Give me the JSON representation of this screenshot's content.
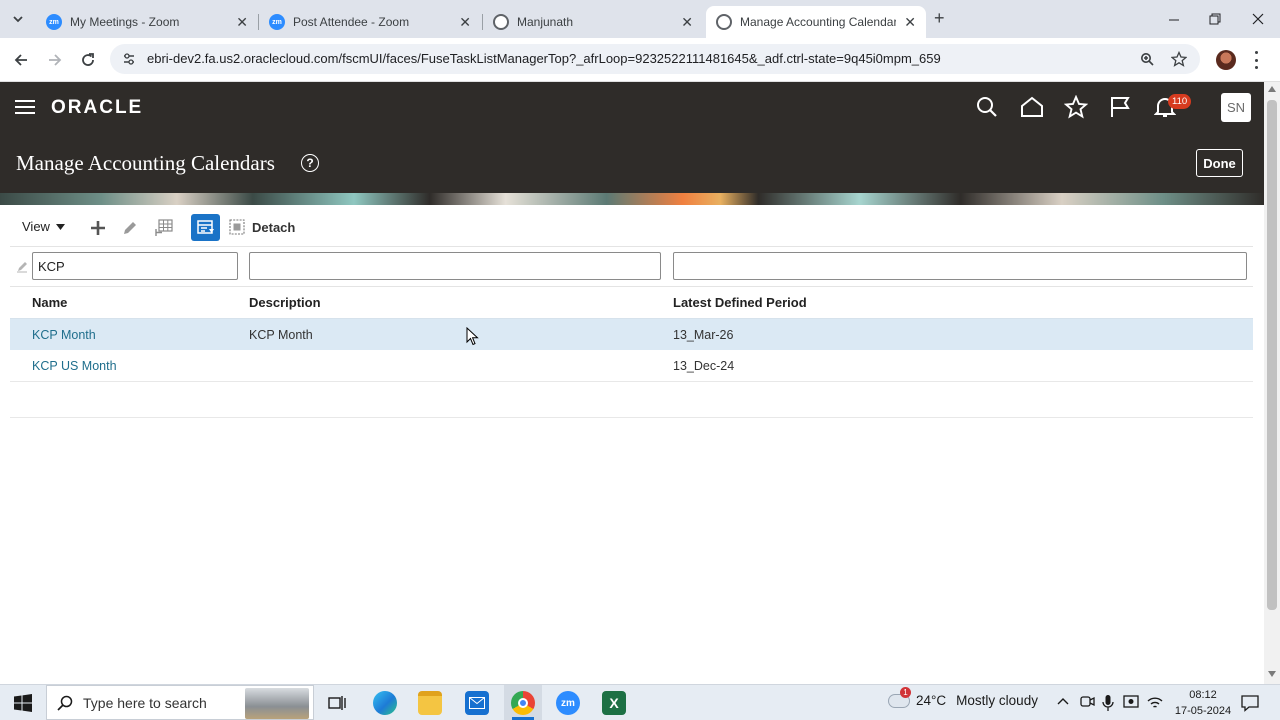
{
  "browser": {
    "tabs": [
      {
        "title": "My Meetings - Zoom",
        "icon": "zoom-icon"
      },
      {
        "title": "Post Attendee - Zoom",
        "icon": "zoom-icon"
      },
      {
        "title": "Manjunath",
        "icon": "globe-icon"
      },
      {
        "title": "Manage Accounting Calendars",
        "icon": "globe-icon"
      }
    ],
    "tab_close": "✕",
    "new_tab": "+",
    "url": "ebri-dev2.fa.us2.oraclecloud.com/fscmUI/faces/FuseTaskListManagerTop?_afrLoop=9232522111481645&_adf.ctrl-state=9q45i0mpm_659",
    "zoom_badge": "zm"
  },
  "app": {
    "logo": "ORACLE",
    "notification_count": "110",
    "user_initials": "SN",
    "page_title": "Manage Accounting Calendars",
    "help_glyph": "?",
    "done_label": "Done"
  },
  "toolbar": {
    "view_label": "View",
    "detach_label": "Detach"
  },
  "filters": {
    "name": "KCP",
    "description": "",
    "latest_period": ""
  },
  "table": {
    "columns": [
      "Name",
      "Description",
      "Latest Defined Period"
    ],
    "rows": [
      {
        "name": "KCP Month",
        "description": "KCP Month",
        "period": "13_Mar-26"
      },
      {
        "name": "KCP US Month",
        "description": "",
        "period": "13_Dec-24"
      }
    ]
  },
  "taskbar": {
    "search_placeholder": "Type here to search",
    "weather_temp": "24°C",
    "weather_text": "Mostly cloudy",
    "weather_badge": "1",
    "time": "08:12",
    "date": "17-05-2024",
    "excel_letter": "X",
    "zoom_badge": "zm"
  },
  "colors": {
    "oracle_header": "#2f2c29",
    "link": "#1f6e8c",
    "selected_row": "#dbe9f4",
    "notification": "#d63b1f"
  }
}
